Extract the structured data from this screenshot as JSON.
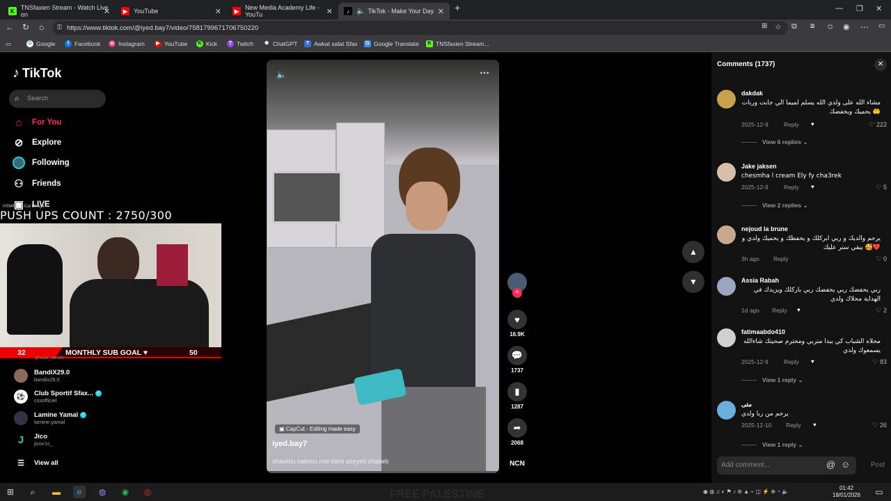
{
  "browser": {
    "tabs": [
      {
        "title": "TNSfaxien Stream - Watch Live on",
        "icon": "K",
        "color": "#53fc18"
      },
      {
        "title": "YouTube",
        "icon": "▶",
        "color": "#ff0000"
      },
      {
        "title": "New Media Academy Life - YouTu",
        "icon": "▶",
        "color": "#ff0000"
      },
      {
        "title": "TikTok - Make Your Day",
        "icon": "♪",
        "color": "#000000"
      }
    ],
    "url": "https://www.tiktok.com/@iyed.bay7/video/7581799671706750220",
    "bookmarks": [
      {
        "label": "Google",
        "icon": "G",
        "color": "#ffffff"
      },
      {
        "label": "Facebook",
        "icon": "f",
        "color": "#1877f2"
      },
      {
        "label": "Instagram",
        "icon": "◎",
        "color": "#e1306c"
      },
      {
        "label": "YouTube",
        "icon": "▶",
        "color": "#ff0000"
      },
      {
        "label": "Kick",
        "icon": "K",
        "color": "#53fc18"
      },
      {
        "label": "Twitch",
        "icon": "T",
        "color": "#9146ff"
      },
      {
        "label": "ChatGPT",
        "icon": "✺",
        "color": "#ffffff"
      },
      {
        "label": "Awkat salat Sfax",
        "icon": "T",
        "color": "#2f6fdb"
      },
      {
        "label": "Google Translate",
        "icon": "G",
        "color": "#4285f4"
      },
      {
        "label": "TNSfaxien Stream...",
        "icon": "K",
        "color": "#53fc18"
      }
    ]
  },
  "tiktok": {
    "logo": "TikTok",
    "search_placeholder": "Search",
    "nav": {
      "for_you": "For You",
      "explore": "Explore",
      "following": "Following",
      "friends": "Friends",
      "live": "LIVE"
    },
    "following_accounts": [
      {
        "name": "BandiX29.0",
        "handle": "bandix29.0",
        "verified": false,
        "color": "#8a6a5a"
      },
      {
        "name": "Club Sportif Sfax...",
        "handle": "cssofficiel",
        "verified": true,
        "color": "#ffffff"
      },
      {
        "name": "Lamine Yamal",
        "handle": "lamine.yamal",
        "verified": true,
        "color": "#334"
      },
      {
        "name": "Jico",
        "handle": "jicov1c_",
        "verified": false,
        "color": "#1fd18a"
      }
    ],
    "partial_handle": "gharja_iarrah",
    "view_all": "View all",
    "accent": "#fe2c55"
  },
  "overlay": {
    "pushups": "PUSH UPS COUNT : 2750/300",
    "tiny": "HSMK tu a-Cal Dhaga",
    "subgoal": {
      "current": "32",
      "label": "MONTHLY SUB GOAL ♥",
      "target": "50",
      "progress": 0.64
    }
  },
  "video": {
    "author": "iyed.bay7",
    "description": "nhawlou naksou mel klem ezeyed chabeb",
    "capcut": "CapCut - Editing made easy",
    "likes": "16.9K",
    "comments": "1737",
    "saves": "1287",
    "shares": "2068",
    "watermark": "NCN"
  },
  "comments": {
    "title": "Comments (1737)",
    "reply_label": "Reply",
    "items": [
      {
        "user": "dakdak",
        "text": "مشاء الله على ولدي الله يسلم لميما الي جابت وربات يحميك ويحفضك 🤲",
        "date": "2025-12-9",
        "likes": "222",
        "view": "View 6 replies",
        "color": "#c8a24a"
      },
      {
        "user": "Jake jaksen",
        "text": "chesmha l cream Ely fy cha3rek",
        "date": "2025-12-9",
        "likes": "5",
        "view": "View 2 replies",
        "color": "#d8c0a8"
      },
      {
        "user": "nejoud la brune",
        "text": "يرحم والديك و ربي ابركلك و يحفظك و يحميك ولدي و يبقي ستر عليك 🥰❤️",
        "date": "3h ago",
        "likes": "0",
        "view": "",
        "color": "#caa890"
      },
      {
        "user": "Assia Rabah",
        "text": "ربي يحفضك ربي يحفضك ربي باركلك ويزيدك في الهداية محلاك ولدي",
        "date": "1d ago",
        "likes": "2",
        "view": "",
        "color": "#9aa6c0"
      },
      {
        "user": "fatimaabdo410",
        "text": "محلاه الشباب كي يبدا متربي ومحترم صحيتك شاءالله يسمعوك ولدي",
        "date": "2025-12-9",
        "likes": "83",
        "view": "View 1 reply",
        "color": "#d0d0d0"
      },
      {
        "user": "متى",
        "text": "يرحم من ربا ولدي",
        "date": "2025-12-10",
        "likes": "26",
        "view": "View 1 reply",
        "color": "#6aaee0"
      }
    ],
    "add_placeholder": "Add comment...",
    "post": "Post"
  },
  "taskbar": {
    "time": "01:42",
    "date": "18/01/2026",
    "banner": "FREE PALESTINE"
  }
}
